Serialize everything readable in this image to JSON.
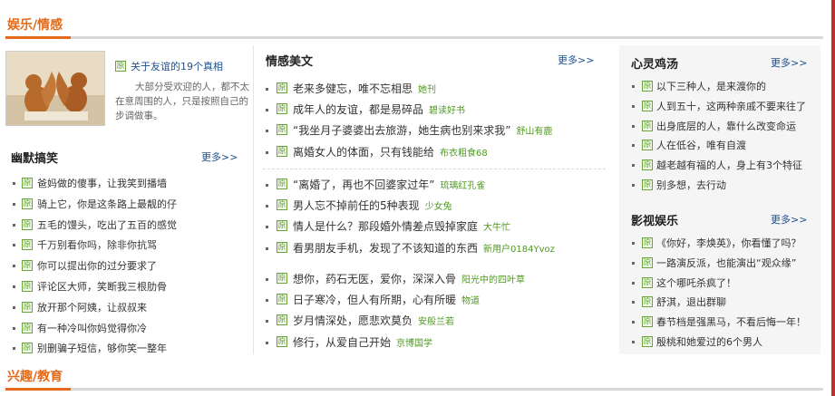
{
  "sections": {
    "top_title": "娱乐/情感",
    "bottom_title": "兴趣/教育"
  },
  "yuan_label": "原",
  "more_label": "更多>>",
  "featured": {
    "title": "关于友谊的19个真相",
    "summary": "大部分受欢迎的人，都不太在意周围的人，只是按照自己的步调做事。",
    "image": "squirrels-photo"
  },
  "humor": {
    "title": "幽默搞笑",
    "items": [
      "爸妈做的傻事，让我笑到播墙",
      "骑上它，你是这条路上最靓的仔",
      "五毛的馒头，吃出了五百的感觉",
      "千万别看你吗，除非你抗骂",
      "你可以提出你的过分要求了",
      "评论区大师，笑断我三根肋骨",
      "放开那个阿姨，让叔叔来",
      "有一种冷叫你妈觉得你冷",
      "别删骗子短信，够你笑一整年"
    ]
  },
  "emotion": {
    "title": "情感美文",
    "group1": [
      {
        "text": "老来多健忘，唯不忘相思",
        "author": "她刊"
      },
      {
        "text": "成年人的友谊，都是易碎品",
        "author": "碧读好书"
      },
      {
        "text": "“我坐月子婆婆出去旅游，她生病也别来求我”",
        "author": "舒山有鹿"
      },
      {
        "text": "离婚女人的体面，只有钱能给",
        "author": "布衣粗食68"
      }
    ],
    "group2": [
      {
        "text": "“离婚了，再也不回婆家过年”",
        "author": "琉璃红孔雀"
      },
      {
        "text": "男人忘不掉前任的5种表现",
        "author": "少女兔"
      },
      {
        "text": "情人是什么？那段婚外情差点毁掉家庭",
        "author": "大牛忙"
      },
      {
        "text": "看男朋友手机，发现了不该知道的东西",
        "author": "新用户0184Yvoz"
      }
    ],
    "group3": [
      {
        "text": "想你，药石无医，爱你，深深入骨",
        "author": "阳光中的四叶草"
      },
      {
        "text": "日子寒冷，但人有所期，心有所暖",
        "author": "物道"
      },
      {
        "text": "岁月情深处，愿悲欢莫负",
        "author": "安般兰若"
      },
      {
        "text": "修行，从爱自己开始",
        "author": "京博国学"
      }
    ]
  },
  "soul": {
    "title": "心灵鸡汤",
    "items": [
      "以下三种人，是来渡你的",
      "人到五十，这两种亲戚不要来往了",
      "出身底层的人，靠什么改变命运",
      "人在低谷，唯有自渡",
      "越老越有福的人，身上有3个特征",
      "别多想，去行动"
    ]
  },
  "film": {
    "title": "影视娱乐",
    "items": [
      "《你好，李焕英》，你看懂了吗？",
      "一路演反派，也能演出“观众缘”",
      "这个哪吒杀疯了！",
      "舒淇，退出群聊",
      "春节档是强黑马，不看后悔一年！",
      "殷桃和她爱过的6个男人"
    ]
  },
  "colors": {
    "accent": "#e46a1a",
    "author": "#4e9a1f",
    "link": "#1c4f8f",
    "edge": "#c0312b"
  }
}
